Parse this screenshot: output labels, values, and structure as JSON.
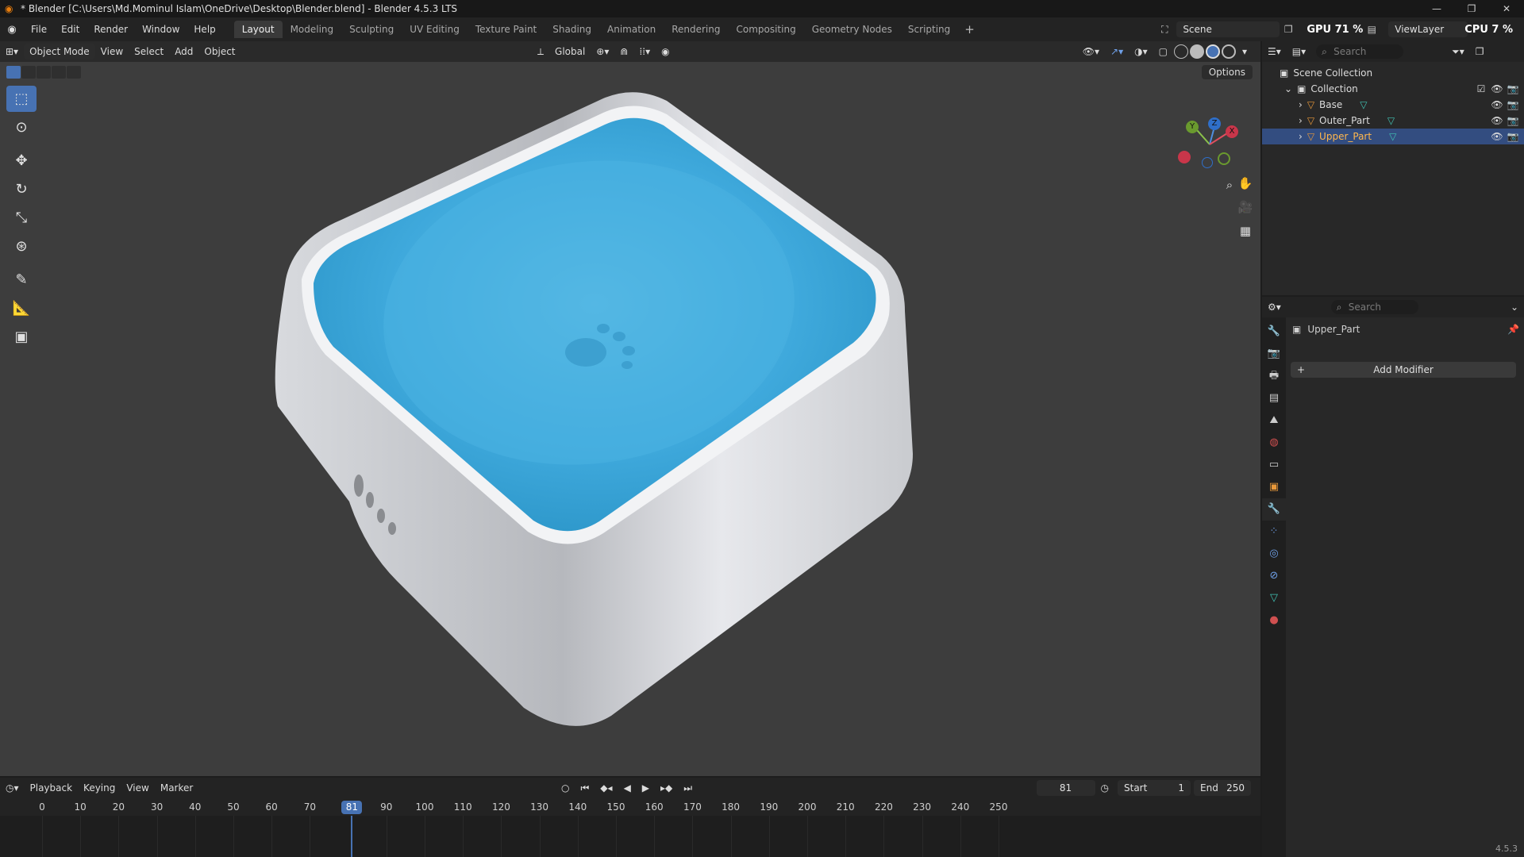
{
  "window": {
    "title": "* Blender [C:\\Users\\Md.Mominul Islam\\OneDrive\\Desktop\\Blender.blend] - Blender 4.5.3 LTS"
  },
  "menu": {
    "items": [
      "File",
      "Edit",
      "Render",
      "Window",
      "Help"
    ]
  },
  "workspaces": {
    "tabs": [
      "Layout",
      "Modeling",
      "Sculpting",
      "UV Editing",
      "Texture Paint",
      "Shading",
      "Animation",
      "Rendering",
      "Compositing",
      "Geometry Nodes",
      "Scripting"
    ],
    "active": "Layout"
  },
  "topbar": {
    "scene": "Scene",
    "gpu": "GPU  71 %",
    "cpu": "CPU  7 %",
    "view_layer": "ViewLayer"
  },
  "viewport_header": {
    "mode": "Object Mode",
    "menus": [
      "View",
      "Select",
      "Add",
      "Object"
    ],
    "orientation": "Global",
    "options": "Options"
  },
  "gizmo": {
    "x": "X",
    "y": "Y",
    "z": "Z"
  },
  "timeline": {
    "menus": [
      "Playback",
      "Keying",
      "View",
      "Marker"
    ],
    "current_frame": "81",
    "start_label": "Start",
    "start": "1",
    "end_label": "End",
    "end": "250",
    "ticks": [
      "0",
      "10",
      "20",
      "30",
      "40",
      "50",
      "60",
      "70",
      "90",
      "100",
      "110",
      "120",
      "130",
      "140",
      "150",
      "160",
      "170",
      "180",
      "190",
      "200",
      "210",
      "220",
      "230",
      "240",
      "250"
    ],
    "playhead_label": "81"
  },
  "outliner": {
    "search_placeholder": "Search",
    "scene_collection": "Scene Collection",
    "collection": "Collection",
    "objects": [
      {
        "name": "Base",
        "selected": false
      },
      {
        "name": "Outer_Part",
        "selected": false
      },
      {
        "name": "Upper_Part",
        "selected": true
      }
    ]
  },
  "properties": {
    "search_placeholder": "Search",
    "object_name": "Upper_Part",
    "add_modifier": "Add Modifier"
  },
  "status": {
    "version": "4.5.3"
  },
  "colors": {
    "accent": "#4772b3",
    "bowl_inner": "#3aa8dc",
    "bowl_body": "#e4e6ea",
    "viewport_bg": "#3d3d3d"
  }
}
